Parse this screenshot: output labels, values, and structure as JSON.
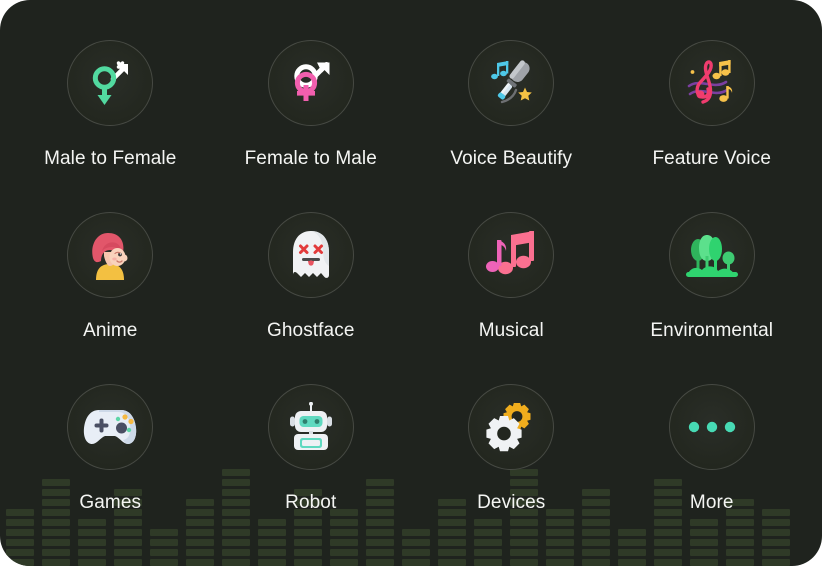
{
  "card": {
    "background_color": "#1f231e",
    "corner_radius_px": 30
  },
  "equalizer": {
    "bar_color": "#2f3a27",
    "column_count": 22,
    "segments_per_column": [
      6,
      9,
      5,
      8,
      4,
      7,
      10,
      5,
      8,
      6,
      9,
      4,
      7,
      5,
      10,
      6,
      8,
      4,
      9,
      5,
      7,
      6
    ]
  },
  "grid": {
    "columns": 4,
    "rows": 3,
    "tiles": [
      {
        "id": "male-to-female",
        "label": "Male to Female",
        "icon": "gender-male-to-female-icon",
        "colors": {
          "primary": "#52d9a0",
          "secondary": "#ffffff"
        }
      },
      {
        "id": "female-to-male",
        "label": "Female to Male",
        "icon": "gender-female-to-male-icon",
        "colors": {
          "primary": "#f25fae",
          "secondary": "#ffffff"
        }
      },
      {
        "id": "voice-beautify",
        "label": "Voice Beautify",
        "icon": "microphone-star-icon",
        "colors": {
          "primary": "#b9bdc2",
          "secondary": "#4ec8e8",
          "accent": "#f6c344"
        }
      },
      {
        "id": "feature-voice",
        "label": "Feature Voice",
        "icon": "treble-clef-notes-icon",
        "colors": {
          "primary": "#ef3c6e",
          "secondary": "#f7c24a",
          "accent": "#7b3fa0"
        }
      },
      {
        "id": "anime",
        "label": "Anime",
        "icon": "anime-girl-icon",
        "colors": {
          "primary": "#e2566a",
          "secondary": "#f7c6ae",
          "accent": "#f3c041"
        }
      },
      {
        "id": "ghostface",
        "label": "Ghostface",
        "icon": "ghost-face-icon",
        "colors": {
          "primary": "#f1f2f4",
          "secondary": "#e23b3b"
        }
      },
      {
        "id": "musical",
        "label": "Musical",
        "icon": "music-notes-icon",
        "colors": {
          "primary": "#fa7090",
          "secondary": "#ee63b8"
        }
      },
      {
        "id": "environmental",
        "label": "Environmental",
        "icon": "trees-nature-icon",
        "colors": {
          "primary": "#2fd36f",
          "secondary": "#57e08c"
        }
      },
      {
        "id": "games",
        "label": "Games",
        "icon": "game-controller-icon",
        "colors": {
          "primary": "#e8eef6",
          "secondary": "#4a4f63",
          "accent": "#f5b942"
        }
      },
      {
        "id": "robot",
        "label": "Robot",
        "icon": "robot-icon",
        "colors": {
          "primary": "#eef1f4",
          "secondary": "#5fd9c0"
        }
      },
      {
        "id": "devices",
        "label": "Devices",
        "icon": "gears-settings-icon",
        "colors": {
          "primary": "#f0f2f4",
          "secondary": "#f0ad1d"
        }
      },
      {
        "id": "more",
        "label": "More",
        "icon": "ellipsis-more-icon",
        "colors": {
          "primary": "#47dab4"
        }
      }
    ]
  }
}
